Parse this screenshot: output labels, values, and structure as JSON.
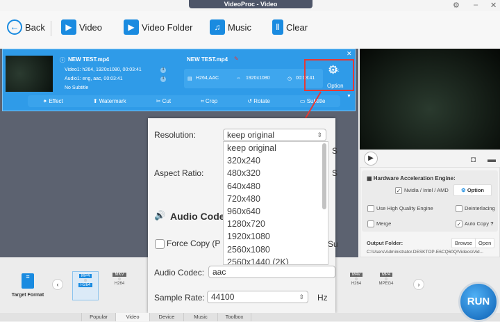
{
  "window": {
    "title": "VideoProc - Video"
  },
  "toolbar": {
    "back": "Back",
    "video": "Video",
    "video_folder": "Video Folder",
    "music": "Music",
    "clear": "Clear"
  },
  "file": {
    "source_name": "NEW TEST.mp4",
    "video_track": "Video1: h264, 1920x1080, 00:03:41",
    "audio_track": "Audio1: eng, aac, 00:03:41",
    "subtitle": "No Subtitle",
    "track_num_video": "1",
    "track_num_audio": "1",
    "output_name": "NEW TEST.mp4",
    "codec": "H264,AAC",
    "resolution": "1920x1080",
    "duration": "00:03:41",
    "codec_badge": "codec",
    "option": "Option"
  },
  "edit_bar": [
    "Effect",
    "Watermark",
    "Cut",
    "Crop",
    "Rotate",
    "Subtitle"
  ],
  "settings": {
    "hw_title": "Hardware Acceleration Engine:",
    "nvidia": "Nvidia / Intel / AMD",
    "option_btn": "Option",
    "high_quality": "Use High Quality Engine",
    "deinterlacing": "Deinterlacing",
    "merge": "Merge",
    "auto_copy": "Auto Copy",
    "help": "?",
    "output_folder": "Output Folder:",
    "browse": "Browse",
    "open": "Open",
    "path": "C:\\Users\\Administrator.DESKTOP-E6CQ60Q\\Videos\\Vid..."
  },
  "dialog": {
    "resolution_label": "Resolution:",
    "resolution_value": "keep original",
    "aspect_label": "Aspect Ratio:",
    "audio_codec_heading": "Audio Code",
    "force_copy": "Force Copy (P",
    "audio_codec_label": "Audio Codec:",
    "audio_codec_value": "aac",
    "sample_rate_label": "Sample Rate:",
    "sample_rate_value": "44100",
    "hz": "Hz",
    "clip_s1": "S",
    "clip_s2": "S",
    "clip_su": "Su"
  },
  "resolution_options": [
    "keep original",
    "320x240",
    "480x320",
    "640x480",
    "720x480",
    "960x640",
    "1280x720",
    "1920x1080",
    "2560x1080",
    "2560x1440 (2K)"
  ],
  "formats": [
    {
      "top": "MP4",
      "bottom": "H264"
    },
    {
      "top": "MKV",
      "bottom": "H264"
    },
    {
      "top": "M4V",
      "bottom": "H264"
    },
    {
      "top": "MP4",
      "bottom": "MPEG4"
    }
  ],
  "target_format": "Target Format",
  "tabs": [
    "Popular",
    "Video",
    "Device",
    "Music",
    "Toolbox"
  ],
  "run": "RUN"
}
